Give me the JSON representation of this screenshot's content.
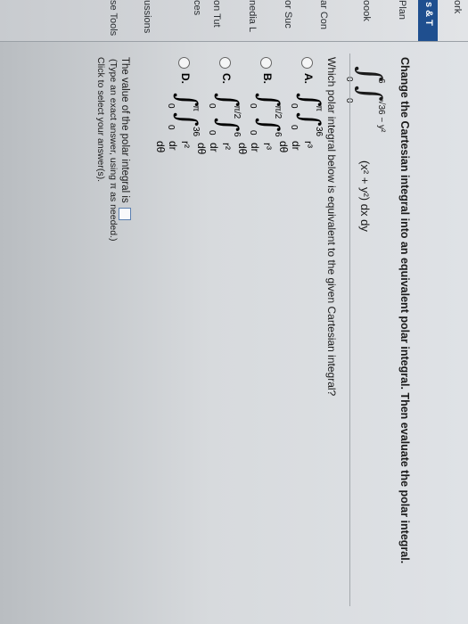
{
  "sidebar": {
    "items": [
      {
        "label": "ork"
      },
      {
        "label": "s & T"
      },
      {
        "label": "Plan"
      },
      {
        "label": "oook"
      },
      {
        "label": "ar Con"
      },
      {
        "label": "or Suc"
      },
      {
        "label": "nedia L"
      },
      {
        "label": "on Tut"
      },
      {
        "label": "ces"
      },
      {
        "label": "ussions"
      },
      {
        "label": "se Tools"
      }
    ]
  },
  "question": {
    "text": "Change the Cartesian integral into an equivalent polar integral. Then evaluate the polar integral.",
    "integral": {
      "outer_lower": "0",
      "outer_upper": "6",
      "inner_lower": "0",
      "inner_upper": "√36 − y²",
      "integrand": "(x² + y²) dx dy"
    }
  },
  "prompt": "Which polar integral below is equivalent to the given Cartesian integral?",
  "options": [
    {
      "letter": "A.",
      "outer_lower": "0",
      "outer_upper": "π",
      "inner_lower": "0",
      "inner_upper": "36",
      "integrand": "r³ dr dθ"
    },
    {
      "letter": "B.",
      "outer_lower": "0",
      "outer_upper": "π/2",
      "inner_lower": "0",
      "inner_upper": "6",
      "integrand": "r³ dr dθ"
    },
    {
      "letter": "C.",
      "outer_lower": "0",
      "outer_upper": "π/2",
      "inner_lower": "0",
      "inner_upper": "6",
      "integrand": "r² dr dθ"
    },
    {
      "letter": "D.",
      "outer_lower": "0",
      "outer_upper": "π",
      "inner_lower": "0",
      "inner_upper": "36",
      "integrand": "r² dr dθ"
    }
  ],
  "answer": {
    "label": "The value of the polar integral is",
    "hint": "(Type an exact answer, using π as needed.)",
    "click": "Click to select your answer(s)."
  }
}
